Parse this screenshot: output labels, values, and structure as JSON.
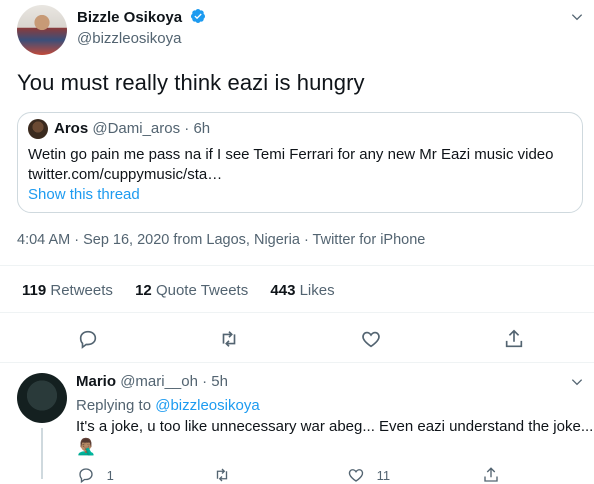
{
  "tweet": {
    "author_name": "Bizzle Osikoya",
    "author_handle": "@bizzleosikoya",
    "text": "You must really think eazi is hungry",
    "quote": {
      "author_name": "Aros",
      "author_handle_time": "@Dami_aros · 6h",
      "text": "Wetin go pain me pass na if I see Temi Ferrari for any new Mr Eazi music video",
      "link": "twitter.com/cuppymusic/sta…",
      "show_thread": "Show this thread"
    },
    "meta": "4:04 AM · Sep 16, 2020 from Lagos, Nigeria · Twitter for iPhone",
    "stats": {
      "retweets_count": "119",
      "retweets_label": "Retweets",
      "quotes_count": "12",
      "quotes_label": "Quote Tweets",
      "likes_count": "443",
      "likes_label": "Likes"
    }
  },
  "reply": {
    "author_name": "Mario",
    "author_handle_time": "@mari__oh · 5h",
    "replying_to_label": "Replying to",
    "replying_to_handle": "@bizzleosikoya",
    "text": "It's a joke, u too like unnecessary war abeg... Even eazi understand the joke...",
    "emoji": "🤦🏽‍♂️",
    "reply_count": "1",
    "like_count": "11"
  },
  "colors": {
    "accent": "#1d9bf0",
    "secondary_text": "#536471",
    "border": "#cfd9de"
  },
  "icons": [
    "verified-badge-icon",
    "chevron-down-icon",
    "reply-icon",
    "retweet-icon",
    "like-icon",
    "share-icon"
  ]
}
